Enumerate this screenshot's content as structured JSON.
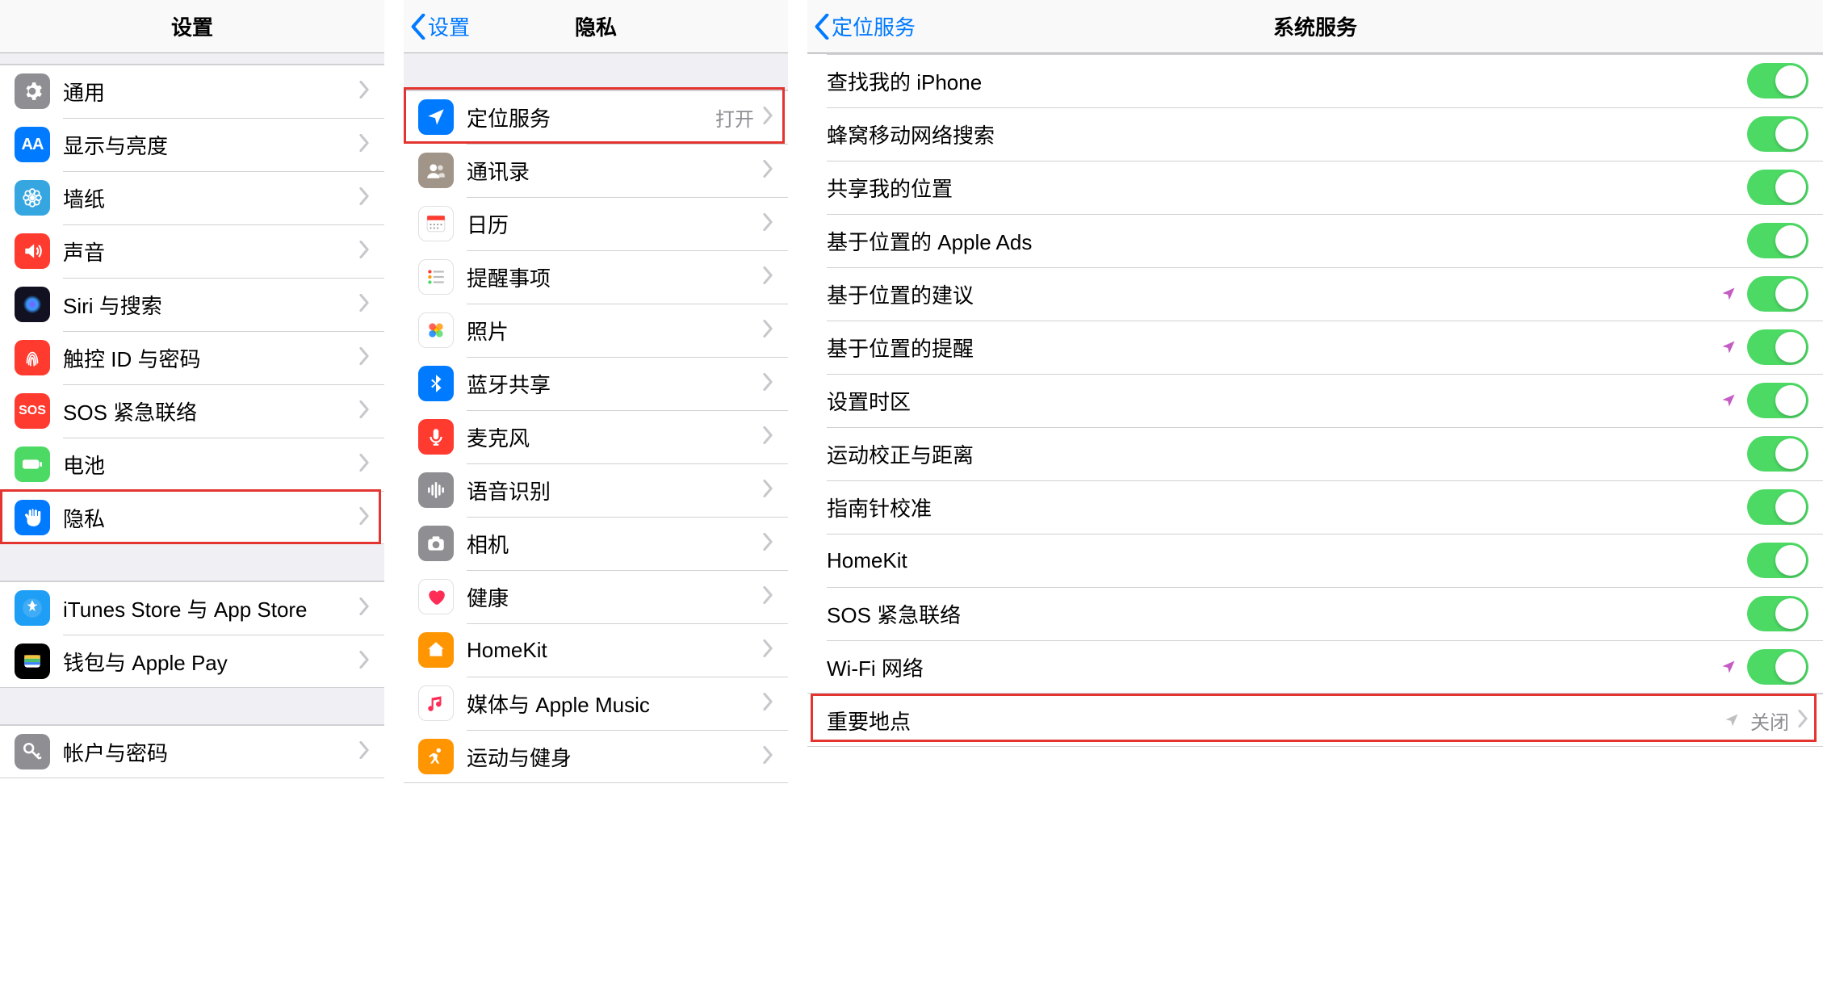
{
  "screen1": {
    "title": "设置",
    "group1": [
      {
        "icon": "gear",
        "icon_bg": "#8e8e93",
        "label": "通用"
      },
      {
        "icon": "aa",
        "icon_bg": "#007aff",
        "label": "显示与亮度"
      },
      {
        "icon": "flower",
        "icon_bg": "#36a6e0",
        "label": "墙纸"
      },
      {
        "icon": "speaker",
        "icon_bg": "#ff3b30",
        "label": "声音"
      },
      {
        "icon": "siri",
        "icon_bg": "#111122",
        "label": "Siri 与搜索"
      },
      {
        "icon": "touchid",
        "icon_bg": "#ff3b30",
        "label": "触控 ID 与密码"
      },
      {
        "icon": "sos",
        "icon_bg": "#ff3b30",
        "label": "SOS 紧急联络"
      },
      {
        "icon": "battery",
        "icon_bg": "#4cd964",
        "label": "电池"
      },
      {
        "icon": "hand",
        "icon_bg": "#007aff",
        "label": "隐私"
      }
    ],
    "group2": [
      {
        "icon": "appstore",
        "icon_bg": "#1e9ef4",
        "label": "iTunes Store 与 App Store"
      },
      {
        "icon": "wallet",
        "icon_bg": "#000000",
        "label": "钱包与 Apple Pay"
      }
    ],
    "group3": [
      {
        "icon": "key",
        "icon_bg": "#8e8e93",
        "label": "帐户与密码"
      }
    ],
    "highlighted_index": 8
  },
  "screen2": {
    "back": "设置",
    "title": "隐私",
    "group1": [
      {
        "icon": "location",
        "icon_bg": "#007aff",
        "label": "定位服务",
        "detail": "打开"
      },
      {
        "icon": "contacts",
        "icon_bg": "#a09588",
        "label": "通讯录"
      },
      {
        "icon": "calendar",
        "icon_bg": "#ffffff",
        "label": "日历",
        "border": true
      },
      {
        "icon": "reminders",
        "icon_bg": "#ffffff",
        "label": "提醒事项",
        "border": true
      },
      {
        "icon": "photos",
        "icon_bg": "#ffffff",
        "label": "照片",
        "border": true
      },
      {
        "icon": "bluetooth",
        "icon_bg": "#007aff",
        "label": "蓝牙共享"
      },
      {
        "icon": "mic",
        "icon_bg": "#ff3b30",
        "label": "麦克风"
      },
      {
        "icon": "waveform",
        "icon_bg": "#8e8e93",
        "label": "语音识别"
      },
      {
        "icon": "camera",
        "icon_bg": "#8e8e93",
        "label": "相机"
      },
      {
        "icon": "health",
        "icon_bg": "#ffffff",
        "label": "健康",
        "border": true
      },
      {
        "icon": "homekit",
        "icon_bg": "#ff9500",
        "label": "HomeKit"
      },
      {
        "icon": "music",
        "icon_bg": "#ffffff",
        "label": "媒体与 Apple Music",
        "border": true
      },
      {
        "icon": "activity",
        "icon_bg": "#ff9500",
        "label": "运动与健身"
      }
    ],
    "highlighted_index": 0
  },
  "screen3": {
    "back": "定位服务",
    "title": "系统服务",
    "items": [
      {
        "label": "查找我的 iPhone",
        "on": true
      },
      {
        "label": "蜂窝移动网络搜索",
        "on": true
      },
      {
        "label": "共享我的位置",
        "on": true
      },
      {
        "label": "基于位置的 Apple Ads",
        "on": true
      },
      {
        "label": "基于位置的建议",
        "on": true,
        "indicator": "purple"
      },
      {
        "label": "基于位置的提醒",
        "on": true,
        "indicator": "purple"
      },
      {
        "label": "设置时区",
        "on": true,
        "indicator": "purple"
      },
      {
        "label": "运动校正与距离",
        "on": true
      },
      {
        "label": "指南针校准",
        "on": true
      },
      {
        "label": "HomeKit",
        "on": true
      },
      {
        "label": "SOS 紧急联络",
        "on": true
      },
      {
        "label": "Wi-Fi 网络",
        "on": true,
        "indicator": "purple"
      }
    ],
    "footer_row": {
      "label": "重要地点",
      "detail": "关闭",
      "indicator": "gray"
    }
  },
  "colors": {
    "indicator_purple": "#c35cc3",
    "indicator_gray": "#bfbfbf"
  }
}
